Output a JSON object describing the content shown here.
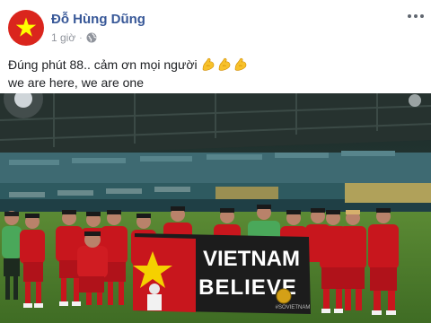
{
  "post": {
    "author": "Đỗ Hùng Dũng",
    "time": "1 giờ",
    "separator": "·",
    "privacy_icon": "globe-icon",
    "more_icon": "more-options-icon",
    "avatar_icon": "vietnam-flag-icon",
    "text_line_1": "Đúng phút 88.. cảm ơn mọi người",
    "emoji": [
      "flexed-biceps-icon",
      "flexed-biceps-icon",
      "flexed-biceps-icon"
    ],
    "text_line_2": "we are here, we are one"
  },
  "photo": {
    "banner_line_1": "VIETNAM",
    "banner_line_2": "BELIEVE",
    "banner_tag": "#SOVIETNAM"
  },
  "colors": {
    "link": "#385898",
    "meta": "#90949c",
    "flag_red": "#da251d",
    "flag_star": "#ffff00",
    "kit_red": "#c8161d",
    "pitch": "#4a7a2c"
  }
}
